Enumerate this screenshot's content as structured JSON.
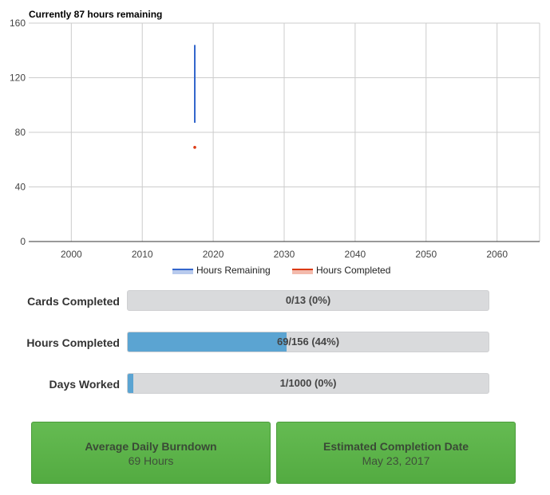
{
  "chart": {
    "title": "Currently 87 hours remaining",
    "legend": [
      {
        "label": "Hours Remaining",
        "color": "#3366cc"
      },
      {
        "label": "Hours Completed",
        "color": "#dc3912"
      }
    ]
  },
  "chart_data": {
    "type": "line",
    "title": "Currently 87 hours remaining",
    "xlabel": "",
    "ylabel": "",
    "xlim": [
      1994,
      2066
    ],
    "ylim": [
      0,
      160
    ],
    "xticks": [
      2000,
      2010,
      2020,
      2030,
      2040,
      2050,
      2060
    ],
    "yticks": [
      0,
      40,
      80,
      120,
      160
    ],
    "grid": true,
    "legend_position": "bottom",
    "series": [
      {
        "name": "Hours Remaining",
        "color": "#3366cc",
        "points": [
          [
            2017.4,
            144
          ],
          [
            2017.4,
            87
          ]
        ]
      },
      {
        "name": "Hours Completed",
        "color": "#dc3912",
        "points": [
          [
            2017.4,
            69
          ]
        ]
      }
    ]
  },
  "progress": {
    "cards": {
      "label": "Cards Completed",
      "text": "0/13 (0%)",
      "fraction": 0
    },
    "hours": {
      "label": "Hours Completed",
      "text": "69/156 (44%)",
      "fraction": 0.44
    },
    "days": {
      "label": "Days Worked",
      "text": "1/1000 (0%)",
      "fraction": 0.001
    }
  },
  "stats": {
    "burndown": {
      "title": "Average Daily Burndown",
      "value": "69 Hours"
    },
    "completion": {
      "title": "Estimated Completion Date",
      "value": "May 23, 2017"
    }
  },
  "colors": {
    "progress_fill": "#5ba4d2",
    "progress_track": "#d9dadc",
    "stat_box": "#5bb34a"
  }
}
